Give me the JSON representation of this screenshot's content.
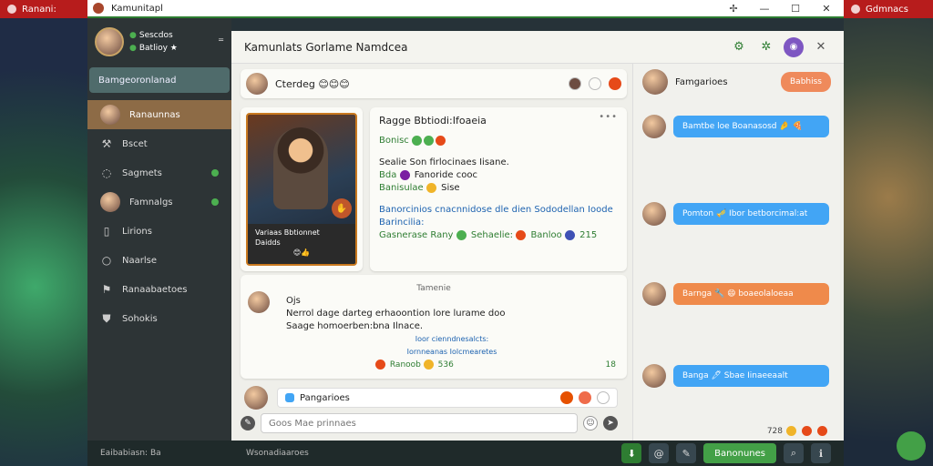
{
  "chrome": {
    "left_label": "Ranani:",
    "right_label": "Gdmnacs"
  },
  "window": {
    "title": "Kamunitapl",
    "controls": {
      "min": "—",
      "max": "☐",
      "close": "✕",
      "pin": "✢"
    }
  },
  "sidebar": {
    "profile": {
      "line1": "Sescdos",
      "line2": "Batlioy ★",
      "menu": "⁼"
    },
    "primary_button": "Bamgeoronlanad",
    "items": [
      {
        "label": "Ranaunnas",
        "icon": "avatar"
      },
      {
        "label": "Bscet",
        "icon": "hammer-icon"
      },
      {
        "label": "Sagmets",
        "icon": "chat-icon"
      },
      {
        "label": "Famnalgs",
        "icon": "avatar"
      },
      {
        "label": "Lirions",
        "icon": "bookmark-icon"
      },
      {
        "label": "Naarlse",
        "icon": "circle-icon"
      },
      {
        "label": "Ranaabaetoes",
        "icon": "flag-icon"
      },
      {
        "label": "Sohokis",
        "icon": "shield-icon"
      }
    ]
  },
  "main": {
    "title": "Kamunlats Gorlame Namdcea",
    "story": {
      "text": "Cterdeg 😊😊😊"
    },
    "hero": {
      "caption1": "Variaas Bbtionnet",
      "caption2": "Daidds",
      "reactions": "😊👍"
    },
    "post": {
      "title": "Ragge Bbtiodi:Ifoaeia",
      "line1": "Bonisc",
      "line2": "Sealie Son firlocinaes Iisane.",
      "line3": "Bda",
      "line3b": "Fanoride cooc",
      "line4": "Banisulae",
      "line4b": "Sise",
      "line5": "Banorcinios cnacnnidose dle dien",
      "line5b": "Sododellan Ioode",
      "line5c": "Barincilia:",
      "line6": "Gasnerase Rany",
      "line6b": "Sehaelie:",
      "line6c": "Banloo",
      "line6d": "215",
      "more": "•••"
    },
    "comment": {
      "tag": "Tamenie",
      "name": "Ojs",
      "text1": "Nerrol dage darteg erhaoontion lore lurame doo",
      "text2": "Saage homoerben:bna Ilnace.",
      "sub1": "Ioor cienndnesalcts:",
      "sub2": "Iornneanas Iolcmearetes",
      "foot": "Ranoob",
      "foot_count": "536",
      "count": "18"
    },
    "composer": {
      "topic": "Pangarioes",
      "placeholder": "Goos Mae prinnaes"
    }
  },
  "right_panel": {
    "head_name": "Famgarioes",
    "follow": "Babhiss",
    "messages": [
      {
        "text": "Bamtbe loe Boanasosd 🤌 🍕",
        "color": "blue"
      },
      {
        "text": "Pomton 🎺 Ibor betborcimal:at",
        "color": "blue"
      },
      {
        "text": "Barnga 🔧 😄 boaeolaloeaa",
        "color": "orange"
      },
      {
        "text": "Banga 🖊 Sbae Iinaeeaalt",
        "color": "blue"
      }
    ],
    "meta": "728"
  },
  "bottombar": {
    "status": "Eaibabiasn: Ba",
    "channel": "Wsonadiaaroes",
    "cta": "Banonunes"
  }
}
